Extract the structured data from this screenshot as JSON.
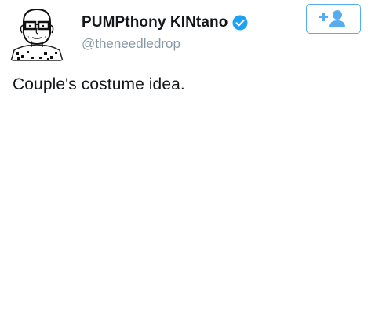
{
  "tweet": {
    "display_name": "PUMPthony KINtano",
    "handle": "@theneedledrop",
    "text": "Couple's costume idea.",
    "verified": true
  },
  "follow_button": {
    "icon": "add-user-icon"
  },
  "colors": {
    "accent": "#55acee",
    "verified": "#1da1f2",
    "name_text": "#14171a",
    "handle_text": "#8899a6"
  }
}
